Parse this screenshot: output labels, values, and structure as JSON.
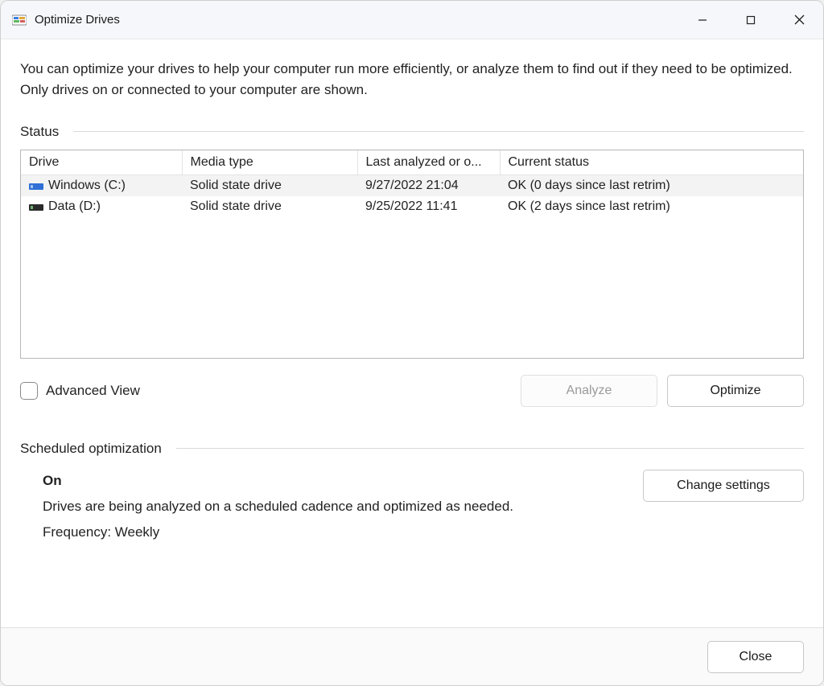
{
  "window": {
    "title": "Optimize Drives"
  },
  "intro": "You can optimize your drives to help your computer run more efficiently, or analyze them to find out if they need to be optimized. Only drives on or connected to your computer are shown.",
  "status": {
    "label": "Status",
    "columns": [
      "Drive",
      "Media type",
      "Last analyzed or o...",
      "Current status"
    ],
    "rows": [
      {
        "drive": "Windows  (C:)",
        "media": "Solid state drive",
        "last": "9/27/2022 21:04",
        "status": "OK (0 days since last retrim)",
        "selected": true,
        "icon": "ssd-blue"
      },
      {
        "drive": "Data (D:)",
        "media": "Solid state drive",
        "last": "9/25/2022 11:41",
        "status": "OK (2 days since last retrim)",
        "selected": false,
        "icon": "ssd-dark"
      }
    ]
  },
  "advanced_view_label": "Advanced View",
  "buttons": {
    "analyze": "Analyze",
    "optimize": "Optimize",
    "change_settings": "Change settings",
    "close": "Close"
  },
  "scheduled": {
    "label": "Scheduled optimization",
    "state": "On",
    "desc": "Drives are being analyzed on a scheduled cadence and optimized as needed.",
    "frequency": "Frequency: Weekly"
  }
}
